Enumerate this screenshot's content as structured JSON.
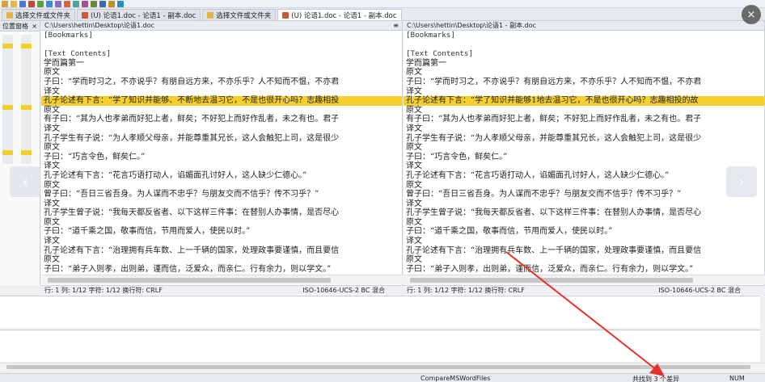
{
  "toolbar": {
    "icons": [
      "new-icon",
      "open-icon",
      "save-icon",
      "cut-icon",
      "copy-icon",
      "paste-icon",
      "undo-icon",
      "redo-icon",
      "compare-icon",
      "merge-icon",
      "prev-diff-icon",
      "next-diff-icon",
      "options-icon",
      "help-icon"
    ]
  },
  "tabs": [
    {
      "label": "选择文件或文件夹",
      "icon": "folder-icon",
      "active": false
    },
    {
      "label": "(U) 论语1.doc - 论语1 - 副本.doc",
      "icon": "compare-doc-icon",
      "active": false
    },
    {
      "label": "选择文件或文件夹",
      "icon": "folder-icon",
      "active": false
    },
    {
      "label": "(U) 论语1.doc - 论语1 - 副本.doc",
      "icon": "compare-doc-icon",
      "active": true
    }
  ],
  "location_pane": {
    "title": "位置窗格",
    "close": "×"
  },
  "left_pane": {
    "path": "C:\\Users\\hettin\\Desktop\\论语1.doc",
    "status_left": "行: 1  列: 1/12  字符: 1/12  换行符: CRLF",
    "status_right": "ISO-10646-UCS-2 BC 混合",
    "lines": [
      {
        "text": "[Bookmarks]",
        "mono": true,
        "hl": false
      },
      {
        "text": "",
        "mono": true,
        "hl": false
      },
      {
        "text": "[Text Contents]",
        "mono": true,
        "hl": false
      },
      {
        "text": "学而篇第一",
        "mono": false,
        "hl": false
      },
      {
        "text": "原文",
        "mono": false,
        "hl": false
      },
      {
        "text": "子曰：“学而时习之，不亦说乎？有朋自远方来，不亦乐乎？人不知而不愠，不亦君",
        "mono": false,
        "hl": false
      },
      {
        "text": "译文",
        "mono": false,
        "hl": false
      },
      {
        "text": "孔子论述有下言：“学了知识并能够、不断地去温习它，不是也很开心吗？志趣相投",
        "mono": false,
        "hl": true
      },
      {
        "text": "原文",
        "mono": false,
        "hl": false
      },
      {
        "text": "有子曰：“其为人也孝弟而好犯上者，鲜矣；不好犯上而好作乱者，未之有也。君子",
        "mono": false,
        "hl": false
      },
      {
        "text": "译文",
        "mono": false,
        "hl": false
      },
      {
        "text": "孔子学生有子说：“为人孝顺父母亲，并能尊重其兄长，这人会触犯上司，这是很少",
        "mono": false,
        "hl": false
      },
      {
        "text": "原文",
        "mono": false,
        "hl": false
      },
      {
        "text": "子曰：“巧言令色，鲜矣仁。”",
        "mono": false,
        "hl": false
      },
      {
        "text": "译文",
        "mono": false,
        "hl": false
      },
      {
        "text": "孔子论述有下言：“花言巧语打动人，谄媚面孔讨好人，这人缺少仁德心。”",
        "mono": false,
        "hl": false
      },
      {
        "text": "原文",
        "mono": false,
        "hl": false
      },
      {
        "text": "曾子曰：“吾日三省吾身。为人谋而不忠乎？与朋友交而不信乎？传不习乎？”",
        "mono": false,
        "hl": false
      },
      {
        "text": "译文",
        "mono": false,
        "hl": false
      },
      {
        "text": "孔子学生曾子说：“我每天都反省者、以下这样三件事：在替别人办事情，是否尽心",
        "mono": false,
        "hl": false
      },
      {
        "text": "原文",
        "mono": false,
        "hl": false
      },
      {
        "text": "子曰：“道千乘之国，敬事而信，节用而爱人，使民以时。”",
        "mono": false,
        "hl": false
      },
      {
        "text": "译文",
        "mono": false,
        "hl": false
      },
      {
        "text": "孔子论述有下言：“治理拥有兵车数、上一千辆的国家，处理政事要谨慎，而且要信",
        "mono": false,
        "hl": false
      },
      {
        "text": "原文",
        "mono": false,
        "hl": false
      },
      {
        "text": "子曰：“弟子入则孝，出则弟，谨而信，泛爱众，而亲仁。行有余力，则以学文。”",
        "mono": false,
        "hl": false
      }
    ]
  },
  "right_pane": {
    "path": "C:\\Users\\hettin\\Desktop\\论语1 - 副本.doc",
    "status_left": "行: 1  列: 1/12  字符: 1/12  换行符: CRLF",
    "status_right": "ISO-10646-UCS-2 BC 混合",
    "lines": [
      {
        "text": "[Bookmarks]",
        "mono": true,
        "hl": false
      },
      {
        "text": "",
        "mono": true,
        "hl": false
      },
      {
        "text": "[Text Contents]",
        "mono": true,
        "hl": false
      },
      {
        "text": "学而篇第一",
        "mono": false,
        "hl": false
      },
      {
        "text": "原文",
        "mono": false,
        "hl": false
      },
      {
        "text": "子曰：“学而时习之，不亦说乎？有朋自远方来，不亦乐乎？人不知而不愠，不亦君",
        "mono": false,
        "hl": false
      },
      {
        "text": "译文",
        "mono": false,
        "hl": false
      },
      {
        "text": "孔子论述有下言：“学了知识并能够1地去温习它，不是也很开心吗？志趣相投的故",
        "mono": false,
        "hl": true
      },
      {
        "text": "原文",
        "mono": false,
        "hl": false
      },
      {
        "text": "有子曰：“其为人也孝弟而好犯上者，鲜矣；不好犯上而好作乱者，未之有也。君子",
        "mono": false,
        "hl": false
      },
      {
        "text": "译文",
        "mono": false,
        "hl": false
      },
      {
        "text": "孔子学生有子说：“为人孝顺父母亲，并能尊重其兄长，这人会触犯上司，这是很少",
        "mono": false,
        "hl": false
      },
      {
        "text": "原文",
        "mono": false,
        "hl": false
      },
      {
        "text": "子曰：“巧言令色，鲜矣仁。”",
        "mono": false,
        "hl": false
      },
      {
        "text": "译文",
        "mono": false,
        "hl": false
      },
      {
        "text": "孔子论述有下言：“花言巧语打动人，谄媚面孔讨好人，这人缺少仁德心。”",
        "mono": false,
        "hl": false
      },
      {
        "text": "原文",
        "mono": false,
        "hl": false
      },
      {
        "text": "曾子曰：“吾日三省吾身。为人谋而不忠乎？与朋友交而不信乎？传不习乎？”",
        "mono": false,
        "hl": false
      },
      {
        "text": "译文",
        "mono": false,
        "hl": false
      },
      {
        "text": "孔子学生曾子说：“我每天都反省者、以下这样三件事：在替别人办事情，是否尽心",
        "mono": false,
        "hl": false
      },
      {
        "text": "原文",
        "mono": false,
        "hl": false
      },
      {
        "text": "子曰：“道千乘之国，敬事而信，节用而爱人，使民以时。”",
        "mono": false,
        "hl": false
      },
      {
        "text": "译文",
        "mono": false,
        "hl": false
      },
      {
        "text": "孔子论述有下言：“治理拥有兵车数、上一千辆的国家，处理政事要谨慎，而且要信",
        "mono": false,
        "hl": false
      },
      {
        "text": "原文",
        "mono": false,
        "hl": false
      },
      {
        "text": "子曰：“弟子入则孝，出则弟，谨而信，泛爱众，而亲仁。行有余力，则以学文。”",
        "mono": false,
        "hl": false
      }
    ]
  },
  "app_status": {
    "app_name": "CompareMSWordFiles",
    "diff_count": "共找到 3 个差异",
    "num": "NUM"
  },
  "nav": {
    "prev": "‹",
    "next": "›"
  },
  "close_symbol": "×",
  "colors": {
    "highlight": "#f6cf2e",
    "arrow": "#e8312a"
  }
}
